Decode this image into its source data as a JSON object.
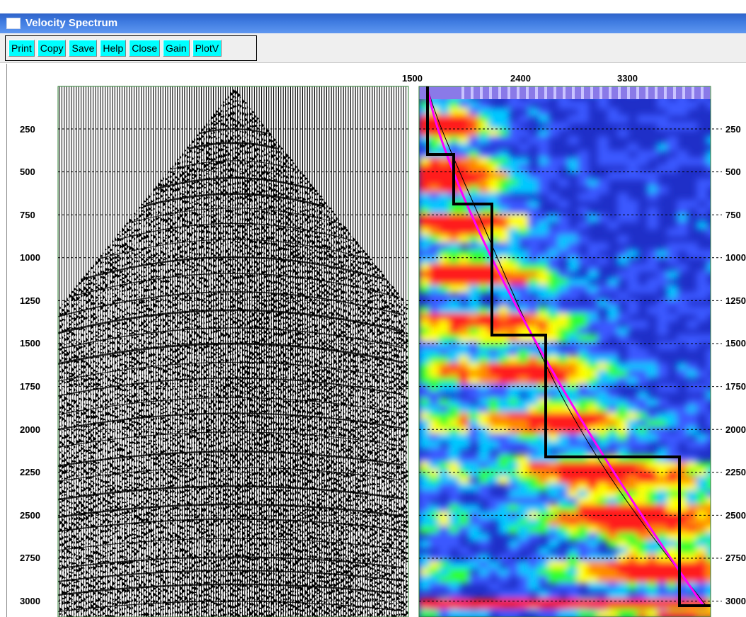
{
  "window": {
    "title": "Velocity Spectrum"
  },
  "toolbar": {
    "buttons": [
      {
        "id": "print",
        "label": "Print"
      },
      {
        "id": "copy",
        "label": "Copy"
      },
      {
        "id": "save",
        "label": "Save"
      },
      {
        "id": "help",
        "label": "Help"
      },
      {
        "id": "close",
        "label": "Close"
      },
      {
        "id": "gain",
        "label": "Gain"
      },
      {
        "id": "plotv",
        "label": "PlotV"
      }
    ]
  },
  "plot": {
    "time_labels": [
      "250",
      "500",
      "750",
      "1000",
      "1250",
      "1500",
      "1750",
      "2000",
      "2250",
      "2500",
      "2750",
      "3000"
    ],
    "time_labels_right": [
      "250",
      "500",
      "750",
      "1000",
      "1250",
      "1500",
      "1750",
      "2000",
      "2250",
      "2500",
      "2750",
      "3000"
    ],
    "velocity_labels": [
      "1500",
      "2400",
      "3300"
    ],
    "colors": {
      "gather_line": "#000000",
      "border": "#2e7d32",
      "nmo_curve": "#ff00ff",
      "interval_velocity": "#000000"
    },
    "spectrum_colors": [
      "#1f2fc8",
      "#3a59ff",
      "#00c8ff",
      "#2fff2f",
      "#ffff00",
      "#ff8c00",
      "#ff1a1a"
    ]
  }
}
